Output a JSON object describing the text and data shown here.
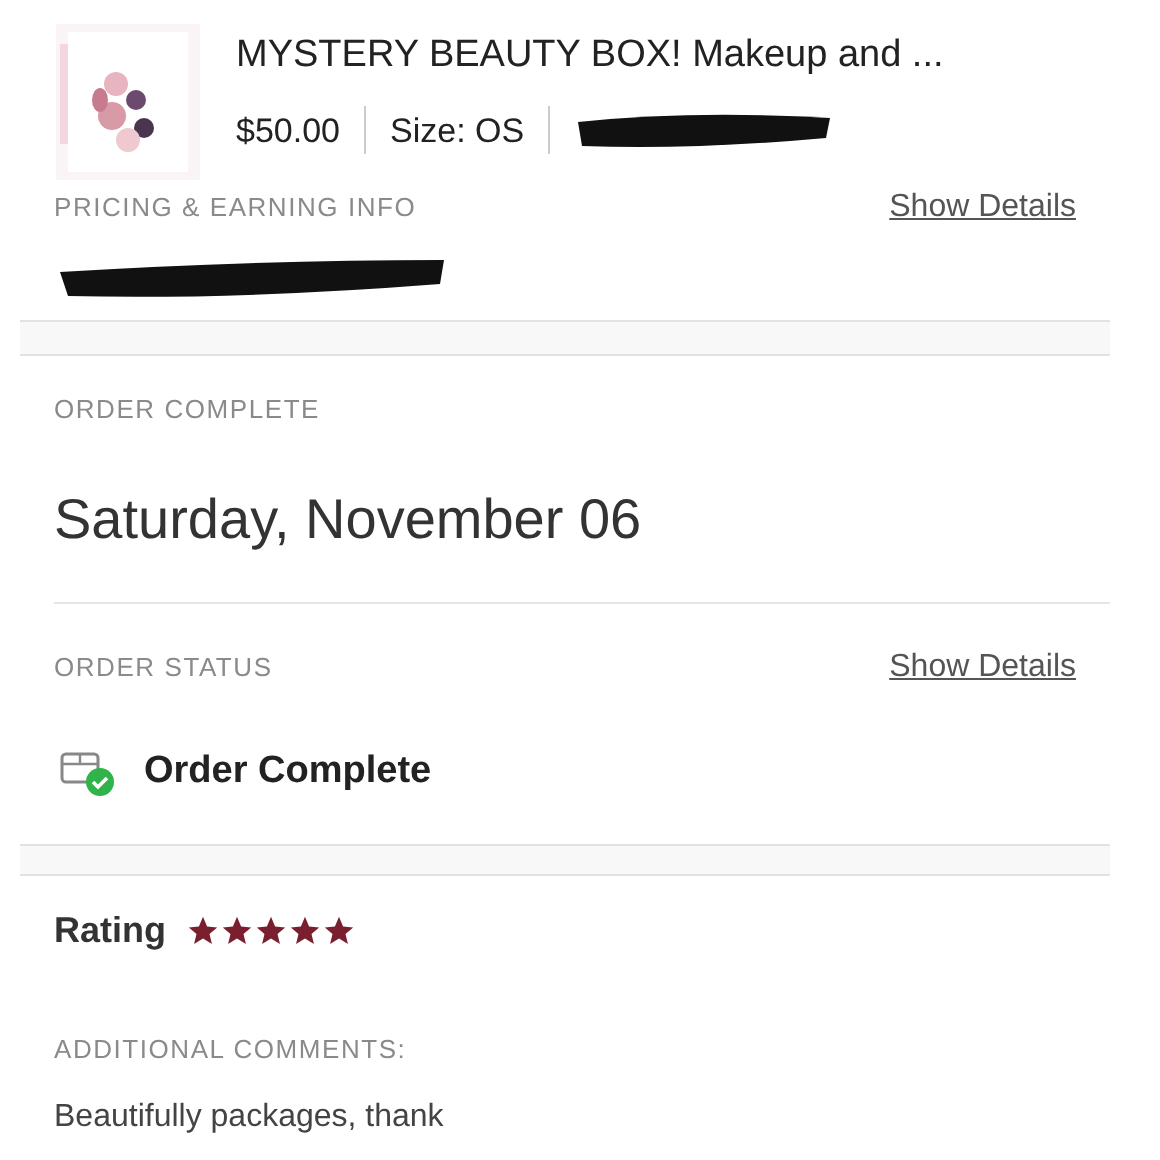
{
  "product": {
    "title": "MYSTERY BEAUTY BOX! Makeup and ...",
    "price": "$50.00",
    "size": "Size: OS"
  },
  "pricing": {
    "label": "PRICING & EARNING INFO",
    "link": "Show Details"
  },
  "order_complete": {
    "label": "ORDER COMPLETE",
    "date": "Saturday, November 06"
  },
  "order_status": {
    "label": "ORDER STATUS",
    "link": "Show Details",
    "status": "Order Complete"
  },
  "rating": {
    "label": "Rating",
    "stars": 5
  },
  "comments": {
    "label": "ADDITIONAL COMMENTS:",
    "text": "Beautifully packages, thank"
  }
}
